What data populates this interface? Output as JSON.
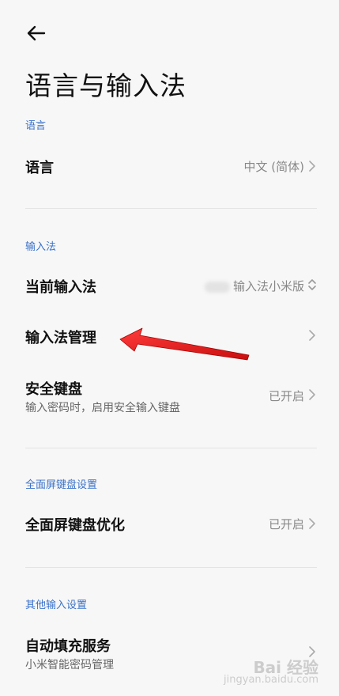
{
  "page": {
    "title": "语言与输入法"
  },
  "sections": {
    "language": {
      "label": "语言",
      "language_row": {
        "title": "语言",
        "value": "中文 (简体)"
      }
    },
    "input_method": {
      "label": "输入法",
      "current": {
        "title": "当前输入法",
        "value": "输入法小米版"
      },
      "manage": {
        "title": "输入法管理"
      },
      "secure_keyboard": {
        "title": "安全键盘",
        "subtitle": "输入密码时，启用安全输入键盘",
        "value": "已开启"
      }
    },
    "fullscreen_keyboard": {
      "label": "全面屏键盘设置",
      "optimize": {
        "title": "全面屏键盘优化",
        "value": "已开启"
      }
    },
    "other_input": {
      "label": "其他输入设置",
      "autofill": {
        "title": "自动填充服务",
        "subtitle": "小米智能密码管理"
      }
    }
  },
  "watermark": {
    "line1": "Bai 经验",
    "line2": "jingyan.baidu.com"
  },
  "icons": [
    "back-arrow-icon",
    "chevron-right-icon",
    "chevron-up-down-icon"
  ],
  "colors": {
    "section_label": "#3a72c9",
    "annotation_arrow": "#e41e1e",
    "background": "#f7f7f7"
  }
}
